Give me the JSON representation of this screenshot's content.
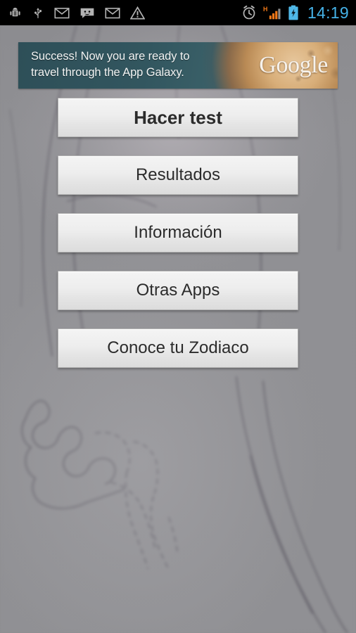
{
  "statusbar": {
    "time": "14:19",
    "left_icons": [
      {
        "name": "android-debug-icon",
        "label": "Android debugging"
      },
      {
        "name": "usb-icon",
        "label": "USB connected"
      },
      {
        "name": "gmail-icon",
        "label": "New Gmail"
      },
      {
        "name": "sms-icon",
        "label": "New message"
      },
      {
        "name": "gmail-icon-2",
        "label": "New Gmail"
      },
      {
        "name": "warning-icon",
        "label": "Warning"
      }
    ],
    "right_icons": [
      {
        "name": "alarm-clock-icon",
        "label": "Alarm set"
      },
      {
        "name": "signal-bars-icon",
        "label": "HSPA signal",
        "network": "H"
      },
      {
        "name": "battery-charging-icon",
        "label": "Battery charging"
      }
    ],
    "colors": {
      "background": "#000000",
      "clock": "#45b2e8",
      "signal": "#f07818",
      "battery": "#4fb8e8",
      "icon": "#b3b3b3"
    }
  },
  "ad": {
    "name": "google-ad-banner",
    "line1": "Success! Now you are ready to",
    "line2": "travel through the App Galaxy.",
    "logo": "Google",
    "colors": {
      "panel": "#33565e",
      "planet": "#c89a66",
      "text": "#f2f4f4"
    }
  },
  "menu": {
    "buttons": [
      {
        "id": "hacer-test",
        "label": "Hacer test",
        "primary": true
      },
      {
        "id": "resultados",
        "label": "Resultados",
        "primary": false
      },
      {
        "id": "informacion",
        "label": "Información",
        "primary": false
      },
      {
        "id": "otras-apps",
        "label": "Otras Apps",
        "primary": false
      },
      {
        "id": "conoce-zodiaco",
        "label": "Conoce tu Zodiaco",
        "primary": false
      }
    ],
    "colors": {
      "face": "#eeeeee",
      "border": "#b4b4b4",
      "text": "#2b2b2b"
    }
  },
  "background": {
    "name": "palm-reading-line-art",
    "base_color": "#8e8e90",
    "line_color": "#4a4652"
  }
}
